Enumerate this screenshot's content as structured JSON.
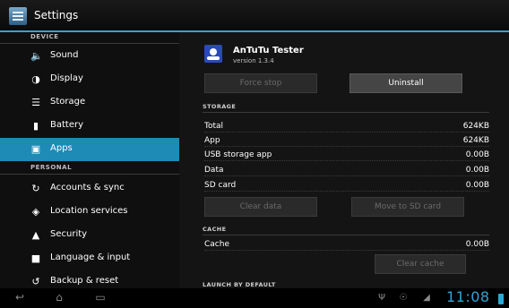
{
  "action_bar": {
    "title": "Settings",
    "icon": "settings-icon"
  },
  "left_pane": {
    "sections": [
      {
        "header": "DEVICE",
        "items": [
          {
            "label": "Sound",
            "icon": "speaker-icon",
            "selected": false
          },
          {
            "label": "Display",
            "icon": "brightness-icon",
            "selected": false
          },
          {
            "label": "Storage",
            "icon": "storage-icon",
            "selected": false
          },
          {
            "label": "Battery",
            "icon": "battery-icon",
            "selected": false
          },
          {
            "label": "Apps",
            "icon": "apps-icon",
            "selected": true
          }
        ]
      },
      {
        "header": "PERSONAL",
        "items": [
          {
            "label": "Accounts & sync",
            "icon": "sync-icon",
            "selected": false
          },
          {
            "label": "Location services",
            "icon": "location-icon",
            "selected": false
          },
          {
            "label": "Security",
            "icon": "lock-icon",
            "selected": false
          },
          {
            "label": "Language & input",
            "icon": "keyboard-icon",
            "selected": false
          },
          {
            "label": "Backup & reset",
            "icon": "backup-icon",
            "selected": false
          }
        ]
      }
    ]
  },
  "app_info": {
    "name": "AnTuTu Tester",
    "version": "version 1.3.4",
    "icon": "antutu-icon",
    "buttons": {
      "force_stop": "Force stop",
      "uninstall": "Uninstall"
    }
  },
  "storage": {
    "header": "STORAGE",
    "rows": [
      {
        "label": "Total",
        "value": "624KB"
      },
      {
        "label": "App",
        "value": "624KB"
      },
      {
        "label": "USB storage app",
        "value": "0.00B"
      },
      {
        "label": "Data",
        "value": "0.00B"
      },
      {
        "label": "SD card",
        "value": "0.00B"
      }
    ],
    "buttons": {
      "clear_data": "Clear data",
      "move_to_sd": "Move to SD card"
    }
  },
  "cache": {
    "header": "CACHE",
    "label": "Cache",
    "value": "0.00B",
    "button": "Clear cache"
  },
  "next_section_header": "LAUNCH BY DEFAULT",
  "system_bar": {
    "time": "11:08",
    "accent_color": "#2fa5d7"
  }
}
